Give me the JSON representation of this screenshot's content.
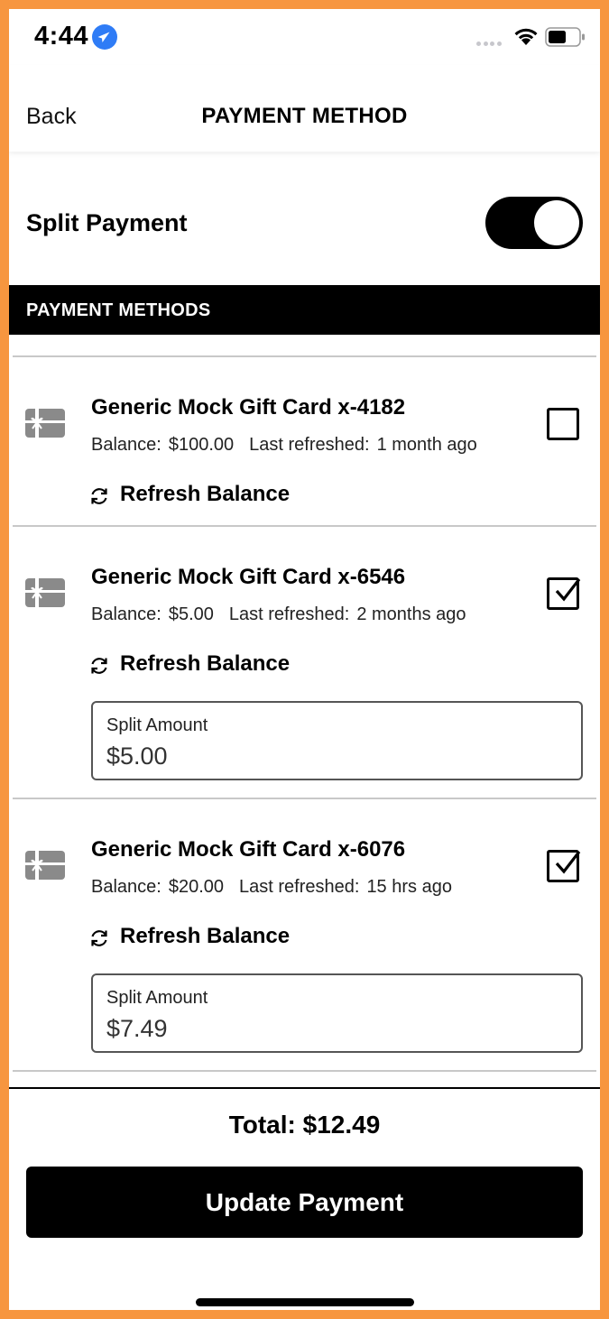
{
  "status_bar": {
    "time": "4:44"
  },
  "nav": {
    "back": "Back",
    "title": "PAYMENT METHOD"
  },
  "split_payment": {
    "label": "Split Payment",
    "enabled": true
  },
  "section_header": "PAYMENT METHODS",
  "refresh_label": "Refresh Balance",
  "split_amount_label": "Split Amount",
  "cards": [
    {
      "name": "Generic Mock Gift Card x-4182",
      "balance_label": "Balance:",
      "balance": "$100.00",
      "refreshed_label": "Last refreshed:",
      "refreshed": "1 month ago",
      "checked": false
    },
    {
      "name": "Generic Mock Gift Card x-6546",
      "balance_label": "Balance:",
      "balance": "$5.00",
      "refreshed_label": "Last refreshed:",
      "refreshed": "2 months ago",
      "checked": true,
      "split_amount": "$5.00"
    },
    {
      "name": "Generic Mock Gift Card x-6076",
      "balance_label": "Balance:",
      "balance": "$20.00",
      "refreshed_label": "Last refreshed:",
      "refreshed": "15 hrs ago",
      "checked": true,
      "split_amount": "$7.49"
    }
  ],
  "footer": {
    "total": "Total: $12.49",
    "button": "Update Payment"
  },
  "icons": {
    "location": "location-arrow-icon",
    "wifi": "wifi-icon",
    "battery": "battery-icon",
    "gift_card": "gift-card-icon",
    "refresh": "refresh-icon",
    "checkbox": "checkbox-icon"
  },
  "colors": {
    "frame": "#F7963F",
    "location": "#2F7CF6",
    "accent": "#000000"
  }
}
